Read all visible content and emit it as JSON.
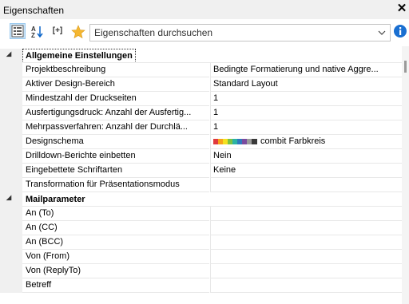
{
  "window": {
    "title": "Eigenschaften"
  },
  "toolbar": {
    "categorized_icon": "categorized-view-icon",
    "alphabetical_icon": "sort-alphabetical-icon",
    "expand_label": "[+]",
    "favorites_icon": "favorites-star-icon",
    "search_placeholder": "Eigenschaften durchsuchen",
    "info_icon": "info-icon"
  },
  "categories": [
    {
      "label": "Allgemeine Einstellungen",
      "expanded": true,
      "properties": [
        {
          "name": "Projektbeschreibung",
          "value": "Bedingte Formatierung und native Aggre..."
        },
        {
          "name": "Aktiver Design-Bereich",
          "value": "Standard Layout"
        },
        {
          "name": "Mindestzahl der Druckseiten",
          "value": "1"
        },
        {
          "name": "Ausfertigungsdruck: Anzahl der Ausfertig...",
          "value": "1"
        },
        {
          "name": "Mehrpassverfahren: Anzahl der Durchlä...",
          "value": "1"
        },
        {
          "name": "Designschema",
          "value": "combit Farbkreis"
        },
        {
          "name": "Drilldown-Berichte einbetten",
          "value": "Nein"
        },
        {
          "name": "Eingebettete Schriftarten",
          "value": "Keine"
        },
        {
          "name": "Transformation für Präsentationsmodus",
          "value": ""
        }
      ]
    },
    {
      "label": "Mailparameter",
      "expanded": true,
      "properties": [
        {
          "name": "An (To)",
          "value": ""
        },
        {
          "name": "An (CC)",
          "value": ""
        },
        {
          "name": "An (BCC)",
          "value": ""
        },
        {
          "name": "Von (From)",
          "value": ""
        },
        {
          "name": "Von (ReplyTo)",
          "value": ""
        },
        {
          "name": "Betreff",
          "value": ""
        }
      ]
    }
  ],
  "design_scheme_colors": [
    "#e03a3e",
    "#f7a21b",
    "#f4e11f",
    "#7cc242",
    "#2bb3a5",
    "#2f79bd",
    "#7b4b9e",
    "#9b9b9b",
    "#3a3a3a"
  ],
  "colors": {
    "accent": "#0a64c8",
    "selection": "#cce4f7",
    "gutter": "#f0f0f0",
    "grid_line": "#e8e8e8"
  }
}
